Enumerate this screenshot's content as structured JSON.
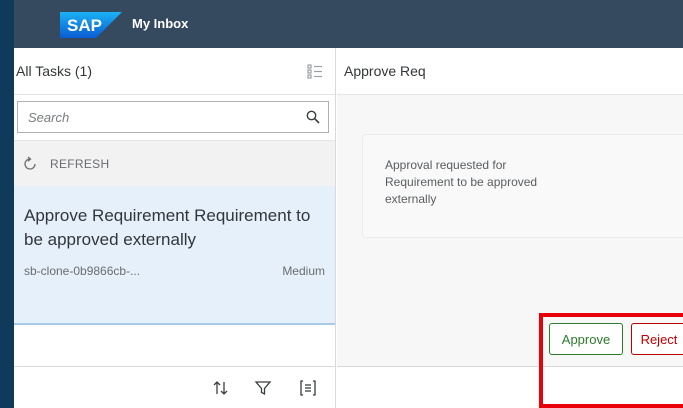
{
  "shell": {
    "brand": "SAP",
    "app_title": "My Inbox"
  },
  "master": {
    "title": "All Tasks (1)",
    "search_placeholder": "Search",
    "refresh_label": "REFRESH",
    "tasks": [
      {
        "title": "Approve Requirement Requirement to be approved externally",
        "id": "sb-clone-0b9866cb-...",
        "priority": "Medium"
      }
    ]
  },
  "detail": {
    "title": "Approve Req",
    "description": "Approval requested for Requirement to be approved externally",
    "approve_label": "Approve",
    "reject_label": "Reject"
  },
  "colors": {
    "shell": "#354a5f",
    "selected": "#e5f0fa",
    "approve": "#2b7c2b",
    "reject": "#bb0000",
    "highlight": "#e8000b"
  },
  "icons": [
    "select-icon",
    "search-icon",
    "refresh-icon",
    "sort-icon",
    "filter-icon",
    "group-icon"
  ]
}
